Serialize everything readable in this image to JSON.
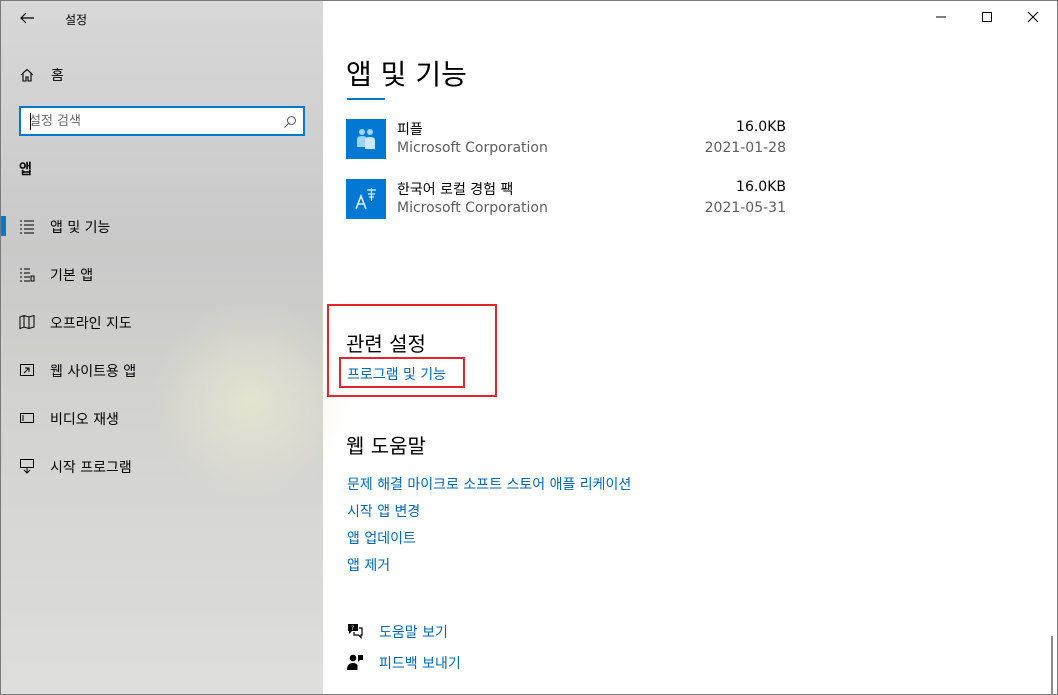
{
  "window": {
    "title": "설정",
    "controls": {
      "minimize": "minimize",
      "maximize": "maximize",
      "close": "close"
    }
  },
  "sidebar": {
    "home_label": "홈",
    "search": {
      "placeholder": "설정 검색"
    },
    "section_label": "앱",
    "items": [
      {
        "label": "앱 및 기능",
        "icon": "apps-features-icon",
        "selected": true
      },
      {
        "label": "기본 앱",
        "icon": "default-apps-icon",
        "selected": false
      },
      {
        "label": "오프라인 지도",
        "icon": "offline-maps-icon",
        "selected": false
      },
      {
        "label": "웹 사이트용 앱",
        "icon": "apps-for-websites-icon",
        "selected": false
      },
      {
        "label": "비디오 재생",
        "icon": "video-playback-icon",
        "selected": false
      },
      {
        "label": "시작 프로그램",
        "icon": "startup-icon",
        "selected": false
      }
    ]
  },
  "main": {
    "page_title": "앱 및 기능",
    "apps": [
      {
        "name": "피플",
        "publisher": "Microsoft Corporation",
        "size": "16.0KB",
        "date": "2021-01-28",
        "icon": "people-icon"
      },
      {
        "name": "한국어 로컬 경험 팩",
        "publisher": "Microsoft Corporation",
        "size": "16.0KB",
        "date": "2021-05-31",
        "icon": "language-pack-icon"
      }
    ],
    "related_settings": {
      "title": "관련 설정",
      "link": "프로그램 및 기능"
    },
    "web_help": {
      "title": "웹 도움말",
      "links": [
        "문제 해결 마이크로 소프트 스토어 애플 리케이션",
        "시작 앱 변경",
        "앱 업데이트",
        "앱 제거"
      ]
    },
    "footer": {
      "help_label": "도움말 보기",
      "feedback_label": "피드백 보내기"
    }
  },
  "colors": {
    "accent": "#0078d4",
    "link": "#0067b8",
    "highlight": "#e3262b"
  }
}
